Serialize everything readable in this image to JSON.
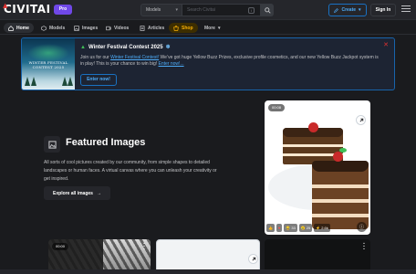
{
  "header": {
    "logo_text": "CIVITAI",
    "pro_label": "Pro",
    "search_select": "Models",
    "search_placeholder": "Search Civitai",
    "search_kbd": "/",
    "create_label": "Create",
    "signin_label": "Sign In"
  },
  "nav": {
    "items": [
      {
        "label": "Home",
        "icon": "home-icon",
        "active": true
      },
      {
        "label": "Models",
        "icon": "cube-icon"
      },
      {
        "label": "Images",
        "icon": "image-icon"
      },
      {
        "label": "Videos",
        "icon": "video-icon"
      },
      {
        "label": "Articles",
        "icon": "article-icon"
      },
      {
        "label": "Shop",
        "icon": "shop-icon",
        "accent": "#fab005"
      }
    ],
    "more_label": "More"
  },
  "banner": {
    "image_title": "WINTER FESTIVAL CONTEST 2025",
    "title": "Winter Festival Contest 2025",
    "text_before": "Join us for our ",
    "link1": "Winter Festival Contest!",
    "text_middle": " We’ve got huge Yellow Buzz Prizes, exclusive profile cosmetics, and our new Yellow Buzz Jackpot system is in play! This is your chance to win big! ",
    "link2": "Enter now!...",
    "button_label": "Enter now!"
  },
  "featured": {
    "title": "Featured Images",
    "description": "All sorts of cool pictures created by our community, from simple shapes to detailed landscapes or human faces. A virtual canvas where you can unleash your creativity or get inspired.",
    "button_label": "Explore all images"
  },
  "cards": {
    "main": {
      "time_badge": "00:08",
      "reactions": [
        {
          "icon": "thumbs-up-icon",
          "count": ""
        },
        {
          "icon": "heart-icon",
          "count": ""
        },
        {
          "icon": "laugh-icon",
          "count": "33"
        },
        {
          "icon": "cry-icon",
          "count": "25"
        },
        {
          "icon": "bolt-icon",
          "count": "2.6k"
        }
      ]
    },
    "bottom1": {
      "time_badge": "00:00"
    }
  },
  "colors": {
    "background": "#1a1b1e",
    "accent_blue": "#4dabf7",
    "brand_purple": "#7048e8",
    "shop_yellow": "#fab005",
    "logo_red": "#e03131"
  }
}
